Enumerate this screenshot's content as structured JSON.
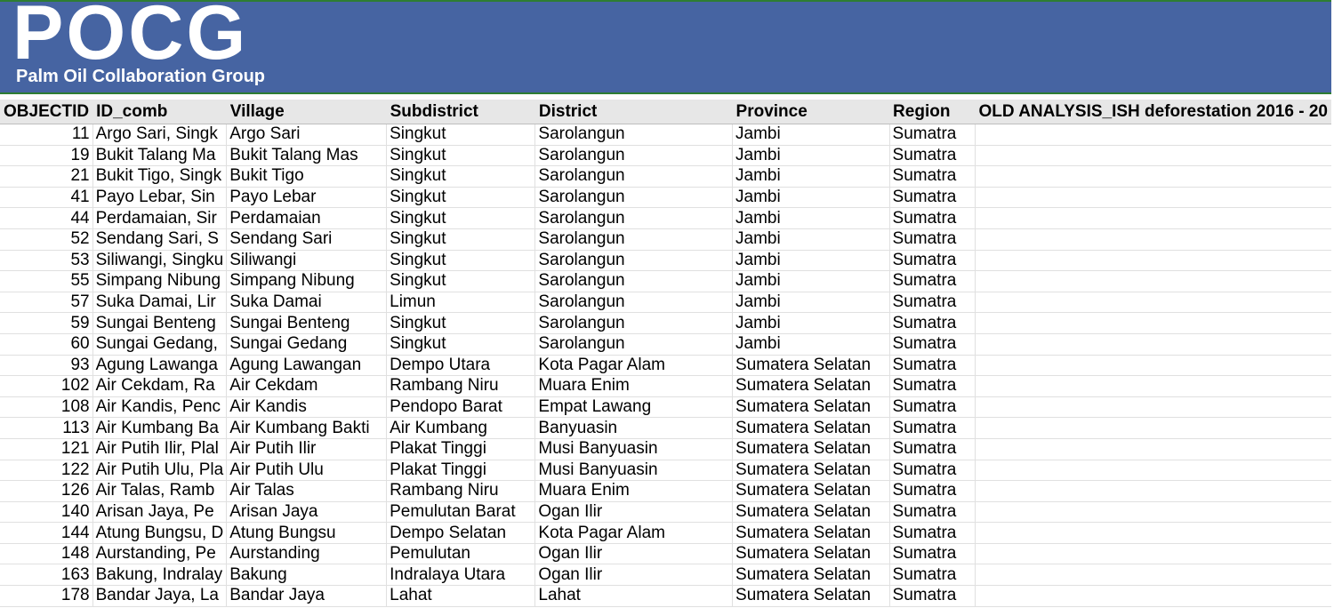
{
  "banner": {
    "logo_wordmark": "POCG",
    "logo_tagline": "Palm Oil Collaboration Group"
  },
  "sheet": {
    "columns": [
      "OBJECTID",
      "ID_comb",
      "Village",
      "Subdistrict",
      "District",
      "Province",
      "Region",
      "OLD ANALYSIS_ISH deforestation 2016 - 20"
    ],
    "rows": [
      [
        "11",
        "Argo Sari, Singk",
        "Argo Sari",
        "Singkut",
        "Sarolangun",
        "Jambi",
        "Sumatra",
        ""
      ],
      [
        "19",
        "Bukit Talang Ma",
        "Bukit Talang Mas",
        "Singkut",
        "Sarolangun",
        "Jambi",
        "Sumatra",
        ""
      ],
      [
        "21",
        "Bukit Tigo, Singk",
        "Bukit Tigo",
        "Singkut",
        "Sarolangun",
        "Jambi",
        "Sumatra",
        ""
      ],
      [
        "41",
        "Payo Lebar, Sin",
        "Payo Lebar",
        "Singkut",
        "Sarolangun",
        "Jambi",
        "Sumatra",
        ""
      ],
      [
        "44",
        "Perdamaian, Sir",
        "Perdamaian",
        "Singkut",
        "Sarolangun",
        "Jambi",
        "Sumatra",
        ""
      ],
      [
        "52",
        "Sendang Sari, S",
        "Sendang Sari",
        "Singkut",
        "Sarolangun",
        "Jambi",
        "Sumatra",
        ""
      ],
      [
        "53",
        "Siliwangi, Singku",
        "Siliwangi",
        "Singkut",
        "Sarolangun",
        "Jambi",
        "Sumatra",
        ""
      ],
      [
        "55",
        "Simpang Nibung",
        "Simpang Nibung",
        "Singkut",
        "Sarolangun",
        "Jambi",
        "Sumatra",
        ""
      ],
      [
        "57",
        "Suka Damai, Lir",
        "Suka Damai",
        "Limun",
        "Sarolangun",
        "Jambi",
        "Sumatra",
        ""
      ],
      [
        "59",
        "Sungai Benteng",
        "Sungai Benteng",
        "Singkut",
        "Sarolangun",
        "Jambi",
        "Sumatra",
        ""
      ],
      [
        "60",
        "Sungai Gedang,",
        "Sungai Gedang",
        "Singkut",
        "Sarolangun",
        "Jambi",
        "Sumatra",
        ""
      ],
      [
        "93",
        "Agung Lawanga",
        "Agung Lawangan",
        "Dempo Utara",
        "Kota Pagar Alam",
        "Sumatera Selatan",
        "Sumatra",
        ""
      ],
      [
        "102",
        "Air Cekdam, Ra",
        "Air Cekdam",
        "Rambang Niru",
        "Muara Enim",
        "Sumatera Selatan",
        "Sumatra",
        ""
      ],
      [
        "108",
        "Air Kandis, Penc",
        "Air Kandis",
        "Pendopo Barat",
        "Empat Lawang",
        "Sumatera Selatan",
        "Sumatra",
        ""
      ],
      [
        "113",
        "Air Kumbang Ba",
        "Air Kumbang Bakti",
        "Air Kumbang",
        "Banyuasin",
        "Sumatera Selatan",
        "Sumatra",
        ""
      ],
      [
        "121",
        "Air Putih Ilir, Plal",
        "Air Putih Ilir",
        "Plakat Tinggi",
        "Musi Banyuasin",
        "Sumatera Selatan",
        "Sumatra",
        ""
      ],
      [
        "122",
        "Air Putih Ulu, Pla",
        "Air Putih Ulu",
        "Plakat Tinggi",
        "Musi Banyuasin",
        "Sumatera Selatan",
        "Sumatra",
        ""
      ],
      [
        "126",
        "Air Talas, Ramb",
        "Air Talas",
        "Rambang Niru",
        "Muara Enim",
        "Sumatera Selatan",
        "Sumatra",
        ""
      ],
      [
        "140",
        "Arisan Jaya, Pe",
        "Arisan Jaya",
        "Pemulutan Barat",
        "Ogan Ilir",
        "Sumatera Selatan",
        "Sumatra",
        ""
      ],
      [
        "144",
        "Atung Bungsu, D",
        "Atung Bungsu",
        "Dempo Selatan",
        "Kota Pagar Alam",
        "Sumatera Selatan",
        "Sumatra",
        ""
      ],
      [
        "148",
        "Aurstanding, Pe",
        "Aurstanding",
        "Pemulutan",
        "Ogan Ilir",
        "Sumatera Selatan",
        "Sumatra",
        ""
      ],
      [
        "163",
        "Bakung, Indralay",
        "Bakung",
        "Indralaya Utara",
        "Ogan Ilir",
        "Sumatera Selatan",
        "Sumatra",
        ""
      ],
      [
        "178",
        "Bandar Jaya, La",
        "Bandar Jaya",
        "Lahat",
        "Lahat",
        "Sumatera Selatan",
        "Sumatra",
        ""
      ]
    ]
  }
}
